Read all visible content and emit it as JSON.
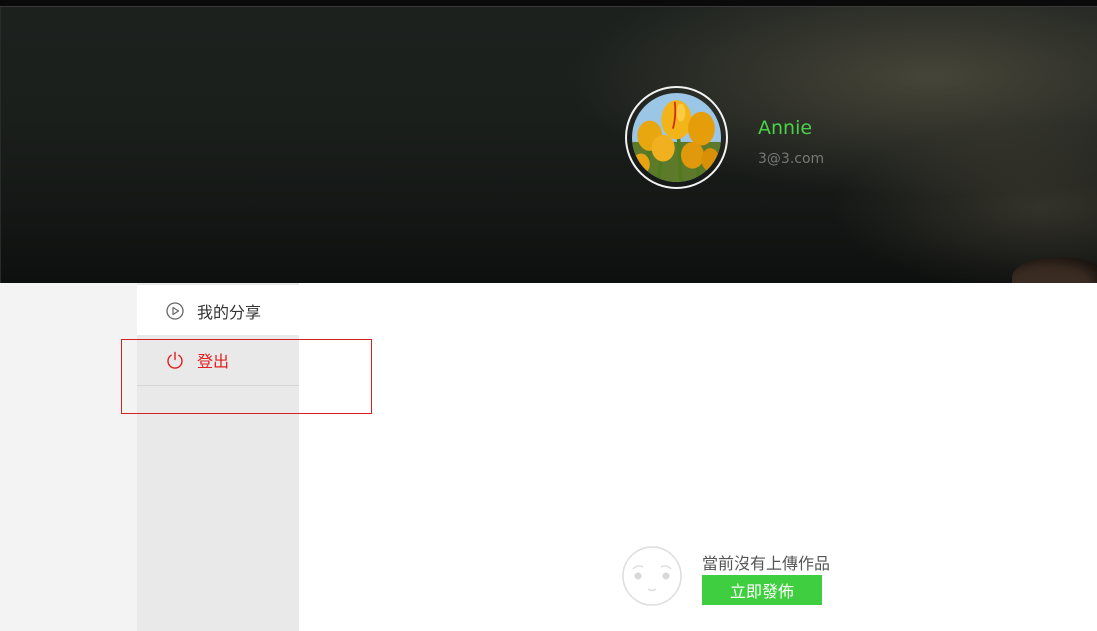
{
  "profile": {
    "name": "Annie",
    "email": "3@3.com",
    "avatar_icon": "tulip-photo"
  },
  "sidebar": {
    "items": [
      {
        "label": "我的分享",
        "icon": "play-circle-icon"
      },
      {
        "label": "登出",
        "icon": "power-icon"
      }
    ]
  },
  "empty_state": {
    "message": "當前沒有上傳作品",
    "button_label": "立即發佈",
    "icon": "neutral-face-icon"
  },
  "colors": {
    "accent_green": "#3fce3f",
    "name_green": "#48d347",
    "logout_red": "#e02020",
    "highlight_red": "#d32020"
  }
}
